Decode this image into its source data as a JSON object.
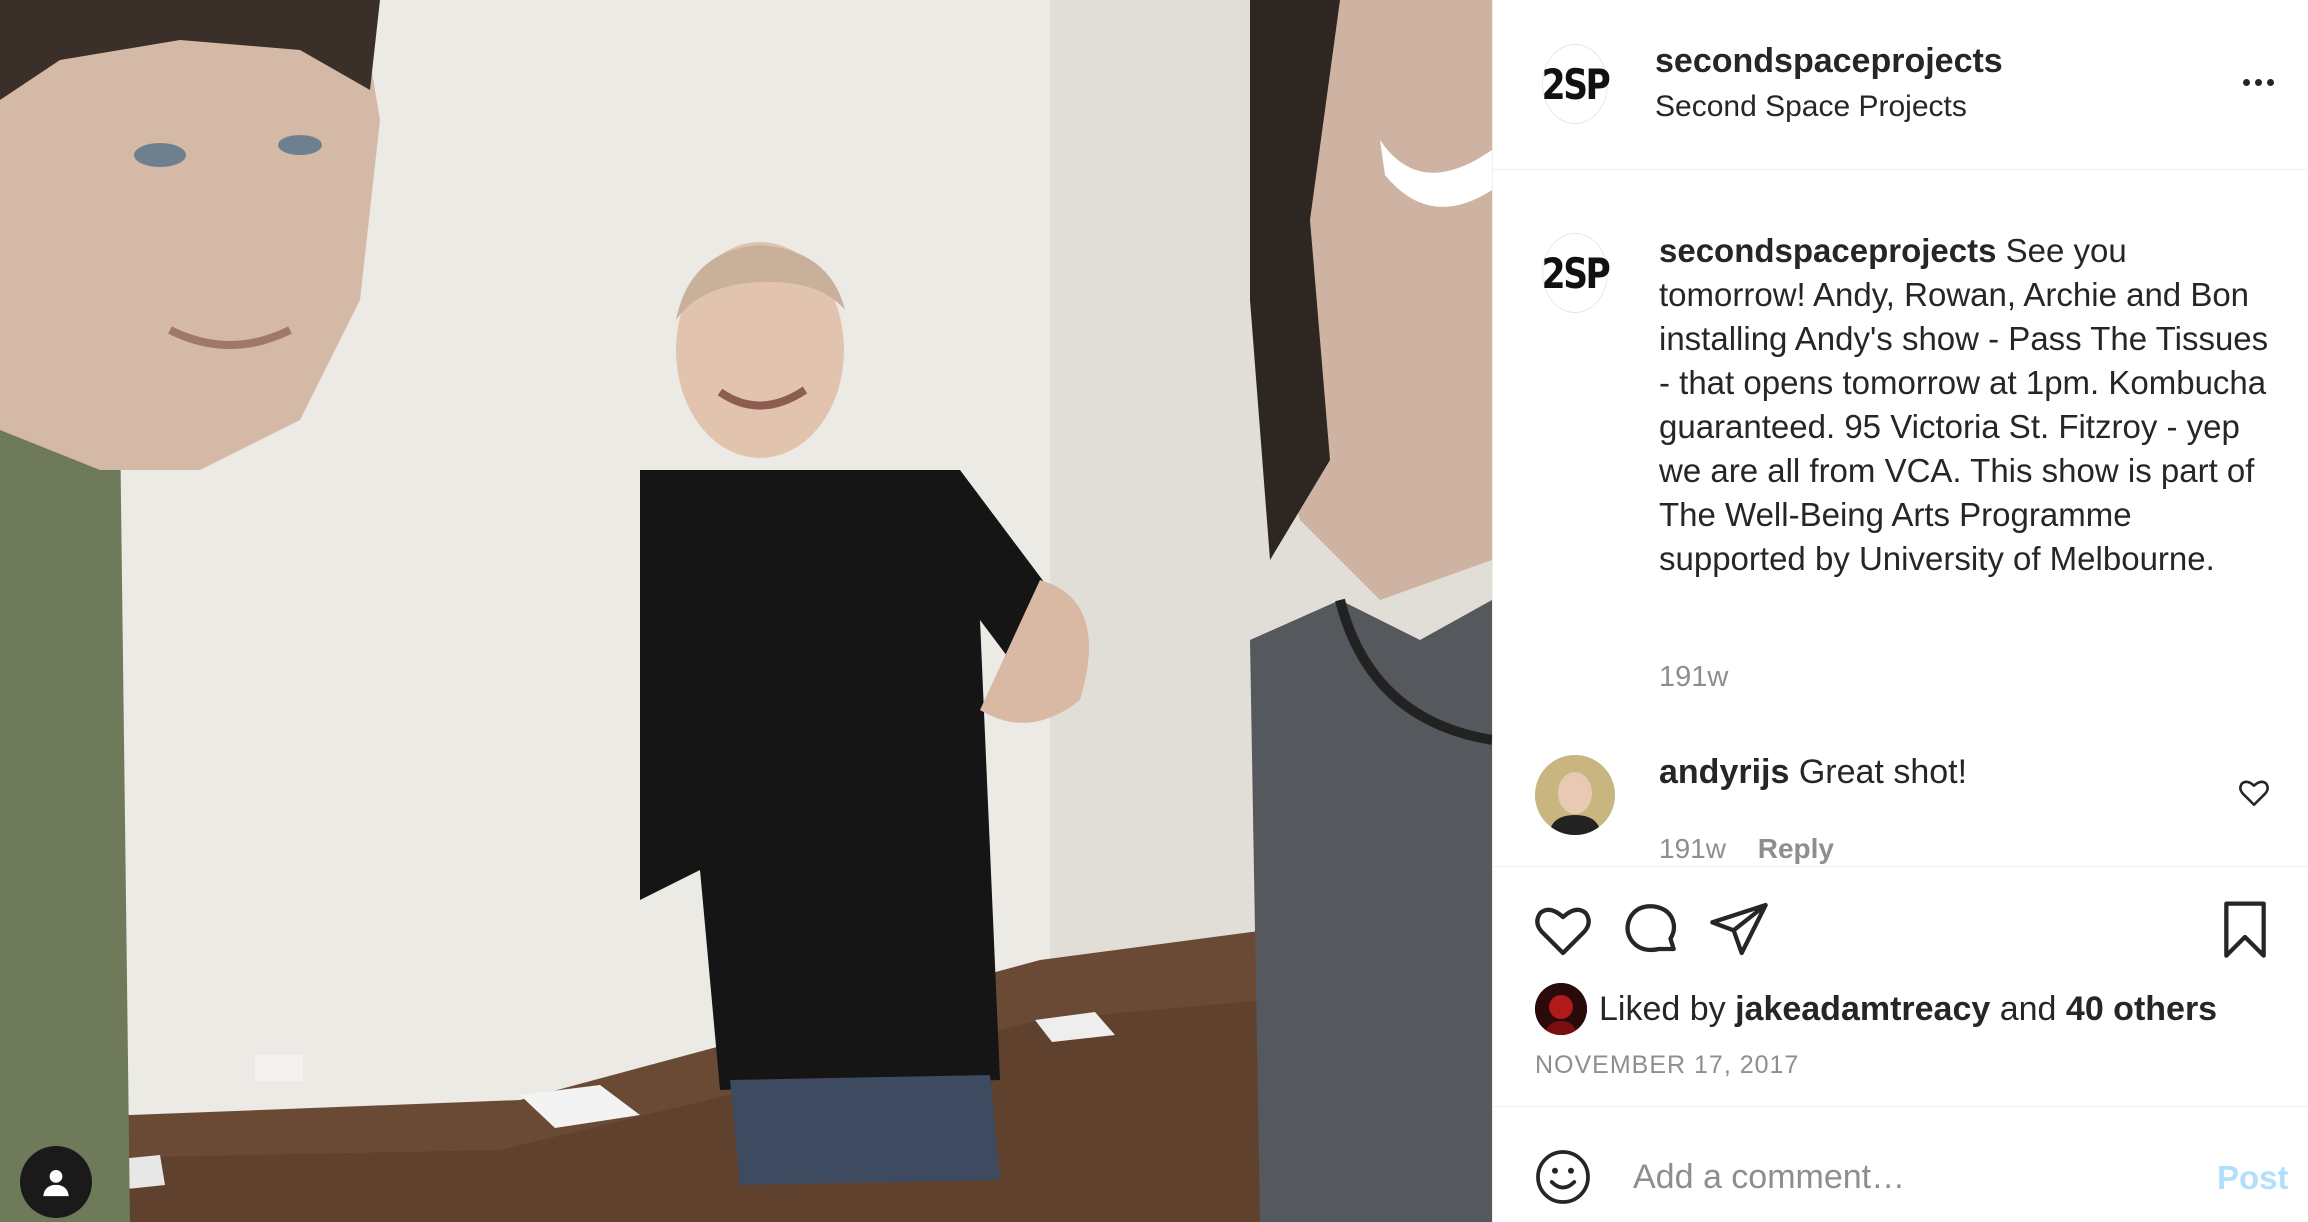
{
  "post": {
    "image_alt": "Three people smiling in an empty gallery room with a wooden floor"
  },
  "header": {
    "logo_text": "2SP",
    "username": "secondspaceprojects",
    "full_name": "Second Space Projects",
    "more_icon": "more-horizontal-icon"
  },
  "caption": {
    "username": "secondspaceprojects",
    "text": "See you tomorrow! Andy, Rowan, Archie and Bon installing Andy's show - Pass The Tissues - that opens tomorrow at 1pm. Kombucha guaranteed. 95 Victoria St. Fitzroy - yep we are all from VCA. This show is part of The Well-Being Arts Programme supported by University of Melbourne.",
    "time": "191w"
  },
  "comments": [
    {
      "username": "andyrijs",
      "text": "Great shot!",
      "time": "191w",
      "reply_label": "Reply"
    }
  ],
  "actions": {
    "icons": [
      "heart-icon",
      "comment-icon",
      "share-icon",
      "bookmark-icon"
    ]
  },
  "likes": {
    "prefix": "Liked by",
    "user": "jakeadamtreacy",
    "and": "and",
    "others": "40 others"
  },
  "date": "NOVEMBER 17, 2017",
  "add_comment": {
    "placeholder": "Add a comment…",
    "post_label": "Post"
  },
  "colors": {
    "text": "#262626",
    "muted": "#8e8e8e",
    "divider": "#efefef",
    "post_disabled": "#b2dffc"
  }
}
